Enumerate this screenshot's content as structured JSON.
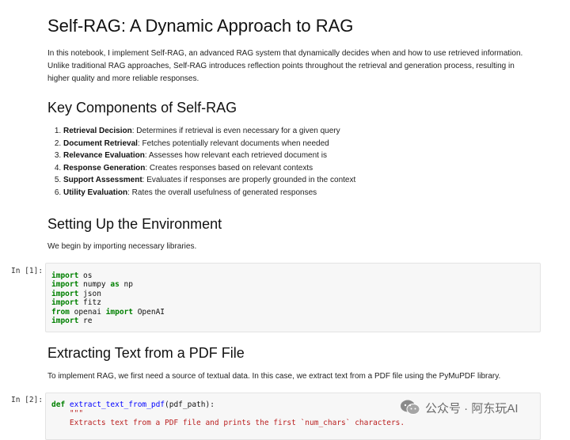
{
  "title": "Self-RAG: A Dynamic Approach to RAG",
  "intro": "In this notebook, I implement Self-RAG, an advanced RAG system that dynamically decides when and how to use retrieved information. Unlike traditional RAG approaches, Self-RAG introduces reflection points throughout the retrieval and generation process, resulting in higher quality and more reliable responses.",
  "section_key": "Key Components of Self-RAG",
  "components": [
    {
      "name": "Retrieval Decision",
      "desc": ": Determines if retrieval is even necessary for a given query"
    },
    {
      "name": "Document Retrieval",
      "desc": ": Fetches potentially relevant documents when needed"
    },
    {
      "name": "Relevance Evaluation",
      "desc": ": Assesses how relevant each retrieved document is"
    },
    {
      "name": "Response Generation",
      "desc": ": Creates responses based on relevant contexts"
    },
    {
      "name": "Support Assessment",
      "desc": ": Evaluates if responses are properly grounded in the context"
    },
    {
      "name": "Utility Evaluation",
      "desc": ": Rates the overall usefulness of generated responses"
    }
  ],
  "section_setup": "Setting Up the Environment",
  "setup_text": "We begin by importing necessary libraries.",
  "cell1": {
    "prompt": "In [1]:",
    "lines": [
      {
        "kw": "import",
        "rest": " os"
      },
      {
        "kw": "import",
        "rest": " numpy ",
        "kw2": "as",
        "rest2": " np"
      },
      {
        "kw": "import",
        "rest": " json"
      },
      {
        "kw": "import",
        "rest": " fitz"
      },
      {
        "kw": "from",
        "rest": " openai ",
        "kw2": "import",
        "rest2": " OpenAI"
      },
      {
        "kw": "import",
        "rest": " re"
      }
    ]
  },
  "section_extract": "Extracting Text from a PDF File",
  "extract_text": "To implement RAG, we first need a source of textual data. In this case, we extract text from a PDF file using the PyMuPDF library.",
  "cell2": {
    "prompt": "In [2]:",
    "def_kw": "def",
    "func_name": "extract_text_from_pdf",
    "func_args": "(pdf_path):",
    "doc_open": "    \"\"\"",
    "doc_line": "    Extracts text from a PDF file and prints the first `num_chars` characters."
  },
  "watermark": "公众号 · 阿东玩AI"
}
